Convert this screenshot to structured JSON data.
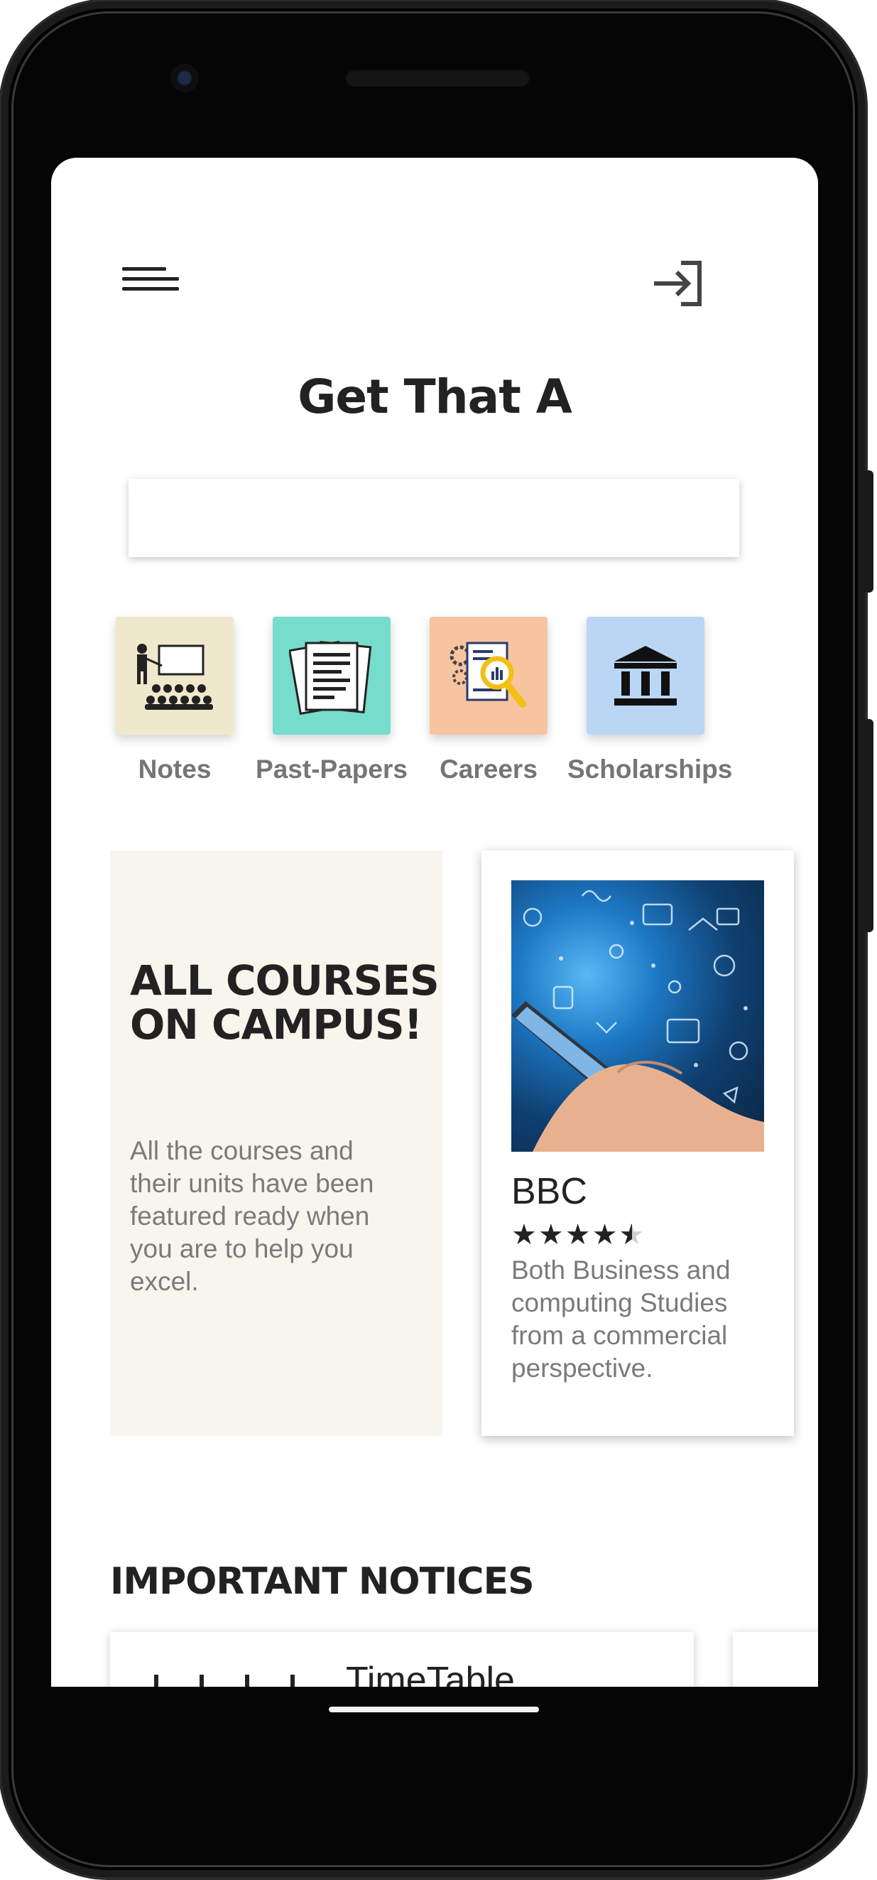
{
  "app": {
    "title": "Get That A"
  },
  "header": {
    "menu_icon": "hamburger-menu-icon",
    "login_icon": "login-arrow-icon"
  },
  "search": {
    "placeholder": "",
    "value": ""
  },
  "categories": [
    {
      "label": "Notes",
      "icon": "classroom-teacher-icon",
      "color": "#f0e8cd"
    },
    {
      "label": "Past-Papers",
      "icon": "documents-icon",
      "color": "#76dccb"
    },
    {
      "label": "Careers",
      "icon": "report-magnifier-icon",
      "color": "#f7c4a0"
    },
    {
      "label": "Scholarships",
      "icon": "institution-icon",
      "color": "#b9d7f5"
    }
  ],
  "promo": {
    "heading": "ALL COURSES ON CAMPUS!",
    "text": "All the courses and their units have been featured ready when you are to help you excel."
  },
  "course": {
    "name": "BBC",
    "rating": 4.5,
    "description": "Both Business and computing Studies from a commercial perspective.",
    "image": "hand-holding-phone-with-doodles-image"
  },
  "notices": {
    "title": "IMPORTANT NOTICES",
    "items": [
      {
        "title": "TimeTable"
      }
    ]
  }
}
